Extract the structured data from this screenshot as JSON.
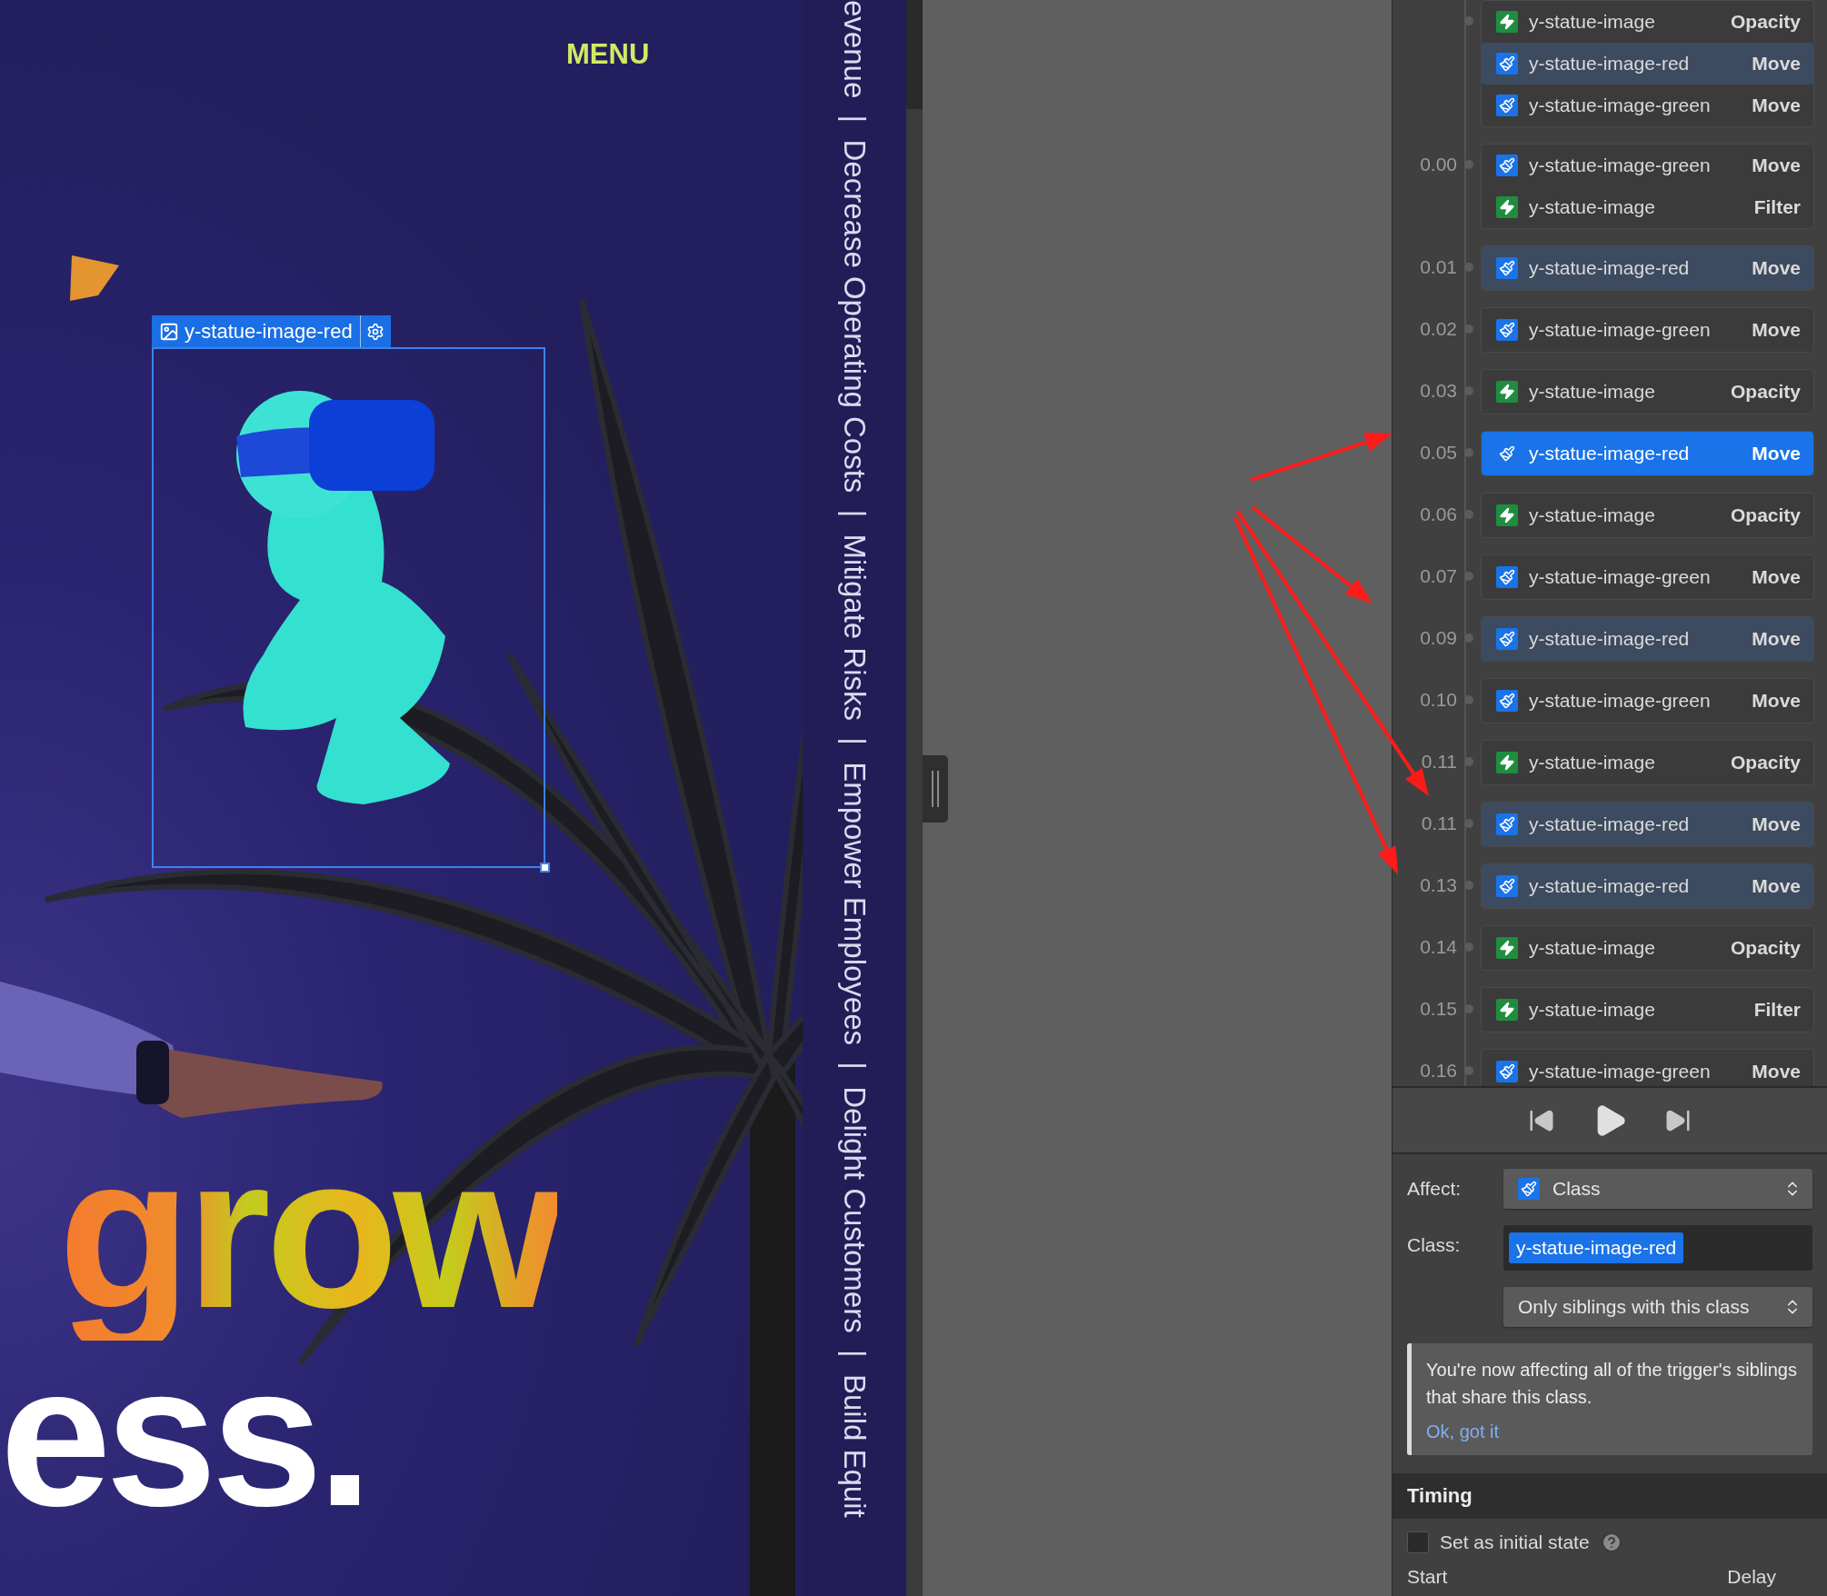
{
  "canvas": {
    "menu": "MENU",
    "selected_element": {
      "name": "y-statue-image-red"
    },
    "marquee": "evenue  |  Decrease Operating Costs  |  Mitigate Risks  |  Empower Employees  |  Delight Customers  |  Build Equit",
    "headline": [
      {
        "text": "grow",
        "kind": "gradient"
      },
      {
        "text": "ess.",
        "kind": "plain"
      }
    ]
  },
  "timeline": {
    "groups": [
      {
        "steps": [
          {
            "target": "y-statue-image",
            "kind": "element",
            "action": "Opacity",
            "selected": false,
            "highlighted": false
          },
          {
            "target": "y-statue-image-red",
            "kind": "class",
            "action": "Move",
            "selected": false,
            "highlighted": true
          },
          {
            "target": "y-statue-image-green",
            "kind": "class",
            "action": "Move",
            "selected": false,
            "highlighted": false
          }
        ]
      },
      {
        "time": "0.00",
        "steps": [
          {
            "target": "y-statue-image-green",
            "kind": "class",
            "action": "Move",
            "selected": false,
            "highlighted": false
          },
          {
            "target": "y-statue-image",
            "kind": "element",
            "action": "Filter",
            "selected": false,
            "highlighted": false
          }
        ]
      },
      {
        "time": "0.01",
        "steps": [
          {
            "target": "y-statue-image-red",
            "kind": "class",
            "action": "Move",
            "selected": false,
            "highlighted": true
          }
        ]
      },
      {
        "time": "0.02",
        "steps": [
          {
            "target": "y-statue-image-green",
            "kind": "class",
            "action": "Move",
            "selected": false,
            "highlighted": false
          }
        ]
      },
      {
        "time": "0.03",
        "steps": [
          {
            "target": "y-statue-image",
            "kind": "element",
            "action": "Opacity",
            "selected": false,
            "highlighted": false
          }
        ]
      },
      {
        "time": "0.05",
        "steps": [
          {
            "target": "y-statue-image-red",
            "kind": "class",
            "action": "Move",
            "selected": true,
            "highlighted": false
          }
        ]
      },
      {
        "time": "0.06",
        "steps": [
          {
            "target": "y-statue-image",
            "kind": "element",
            "action": "Opacity",
            "selected": false,
            "highlighted": false
          }
        ]
      },
      {
        "time": "0.07",
        "steps": [
          {
            "target": "y-statue-image-green",
            "kind": "class",
            "action": "Move",
            "selected": false,
            "highlighted": false
          }
        ]
      },
      {
        "time": "0.09",
        "steps": [
          {
            "target": "y-statue-image-red",
            "kind": "class",
            "action": "Move",
            "selected": false,
            "highlighted": true
          }
        ]
      },
      {
        "time": "0.10",
        "steps": [
          {
            "target": "y-statue-image-green",
            "kind": "class",
            "action": "Move",
            "selected": false,
            "highlighted": false
          }
        ]
      },
      {
        "time": "0.11",
        "steps": [
          {
            "target": "y-statue-image",
            "kind": "element",
            "action": "Opacity",
            "selected": false,
            "highlighted": false
          }
        ]
      },
      {
        "time": "0.11",
        "steps": [
          {
            "target": "y-statue-image-red",
            "kind": "class",
            "action": "Move",
            "selected": false,
            "highlighted": true
          }
        ]
      },
      {
        "time": "0.13",
        "steps": [
          {
            "target": "y-statue-image-red",
            "kind": "class",
            "action": "Move",
            "selected": false,
            "highlighted": true
          }
        ]
      },
      {
        "time": "0.14",
        "steps": [
          {
            "target": "y-statue-image",
            "kind": "element",
            "action": "Opacity",
            "selected": false,
            "highlighted": false
          }
        ]
      },
      {
        "time": "0.15",
        "steps": [
          {
            "target": "y-statue-image",
            "kind": "element",
            "action": "Filter",
            "selected": false,
            "highlighted": false
          }
        ]
      },
      {
        "time": "0.16",
        "steps": [
          {
            "target": "y-statue-image-green",
            "kind": "class",
            "action": "Move",
            "selected": false,
            "highlighted": false
          }
        ]
      }
    ]
  },
  "affect": {
    "label": "Affect:",
    "value": "Class",
    "kind": "class"
  },
  "class_field": {
    "label": "Class:",
    "chip": "y-statue-image-red"
  },
  "scope": {
    "value": "Only siblings with this class"
  },
  "notice": {
    "text": "You're now affecting all of the trigger's siblings that share this class.",
    "link": "Ok, got it"
  },
  "timing": {
    "title": "Timing",
    "initial_state": {
      "label": "Set as initial state",
      "checked": false
    },
    "start_label": "Start",
    "delay_label": "Delay"
  }
}
